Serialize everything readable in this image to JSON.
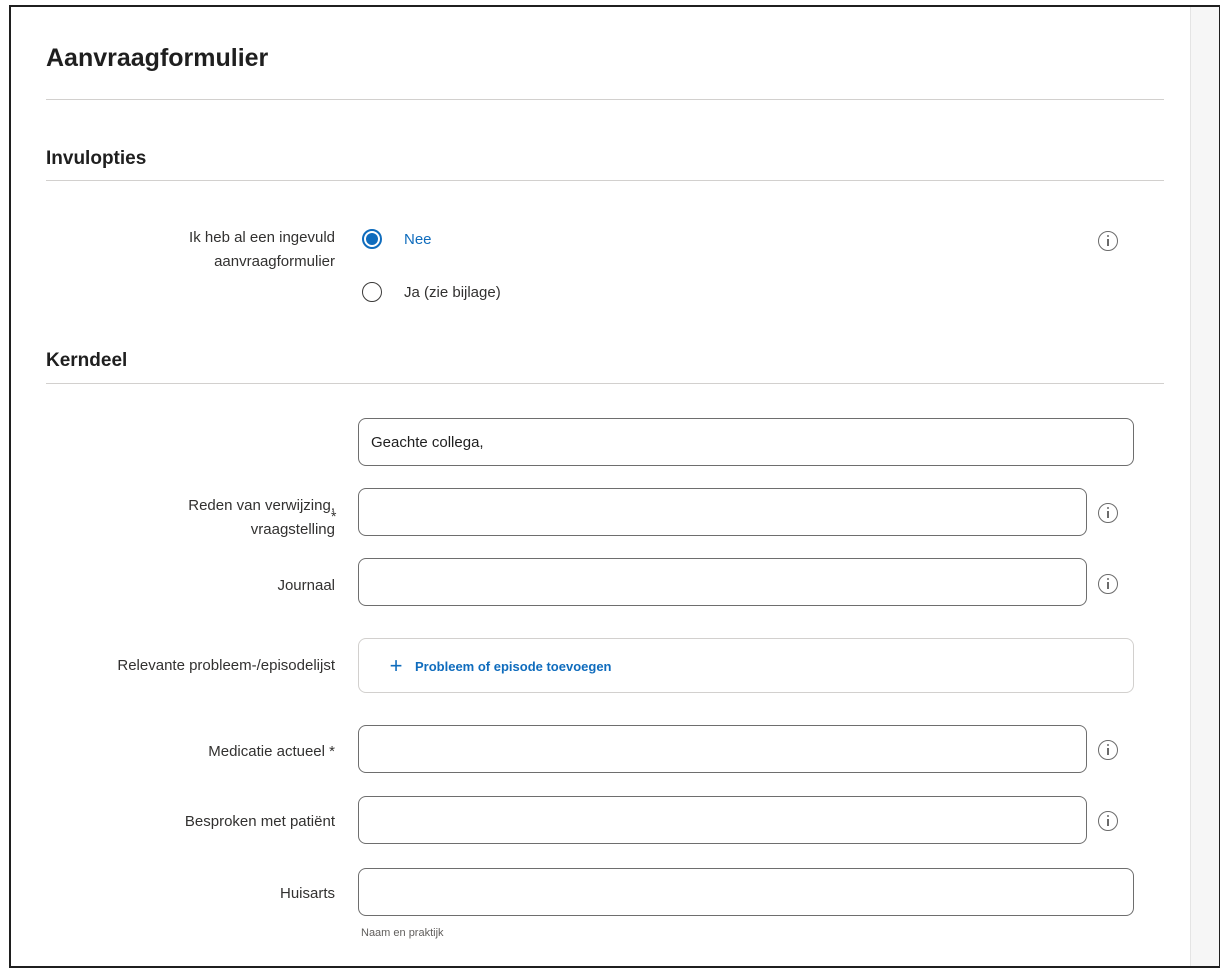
{
  "form": {
    "title": "Aanvraagformulier"
  },
  "invulopties": {
    "title": "Invulopties",
    "question_line1": "Ik heb al een ingevuld",
    "question_line2": "aanvraagformulier",
    "options": [
      {
        "label": "Nee",
        "selected": true
      },
      {
        "label": "Ja (zie bijlage)",
        "selected": false
      }
    ]
  },
  "kerndeel": {
    "title": "Kerndeel",
    "salutation": {
      "value": "Geachte collega,"
    },
    "reden": {
      "label_line1": "Reden van verwijzing,",
      "label_line2": "vraagstelling",
      "required_mark": "*",
      "value": ""
    },
    "journaal": {
      "label": "Journaal",
      "value": ""
    },
    "probleemlijst": {
      "label": "Relevante probleem-/episodelijst",
      "add_icon": "+",
      "add_label": "Probleem of episode toevoegen"
    },
    "medicatie": {
      "label": "Medicatie actueel *",
      "value": ""
    },
    "besproken": {
      "label": "Besproken met patiënt",
      "value": ""
    },
    "huisarts": {
      "label": "Huisarts",
      "value": "",
      "hint": "Naam en praktijk"
    }
  },
  "colors": {
    "accent": "#0f6cbd",
    "border": "#6e6e6e",
    "divider": "#d2d0ce"
  },
  "icons": {
    "info": "info-icon",
    "plus": "plus-icon"
  }
}
